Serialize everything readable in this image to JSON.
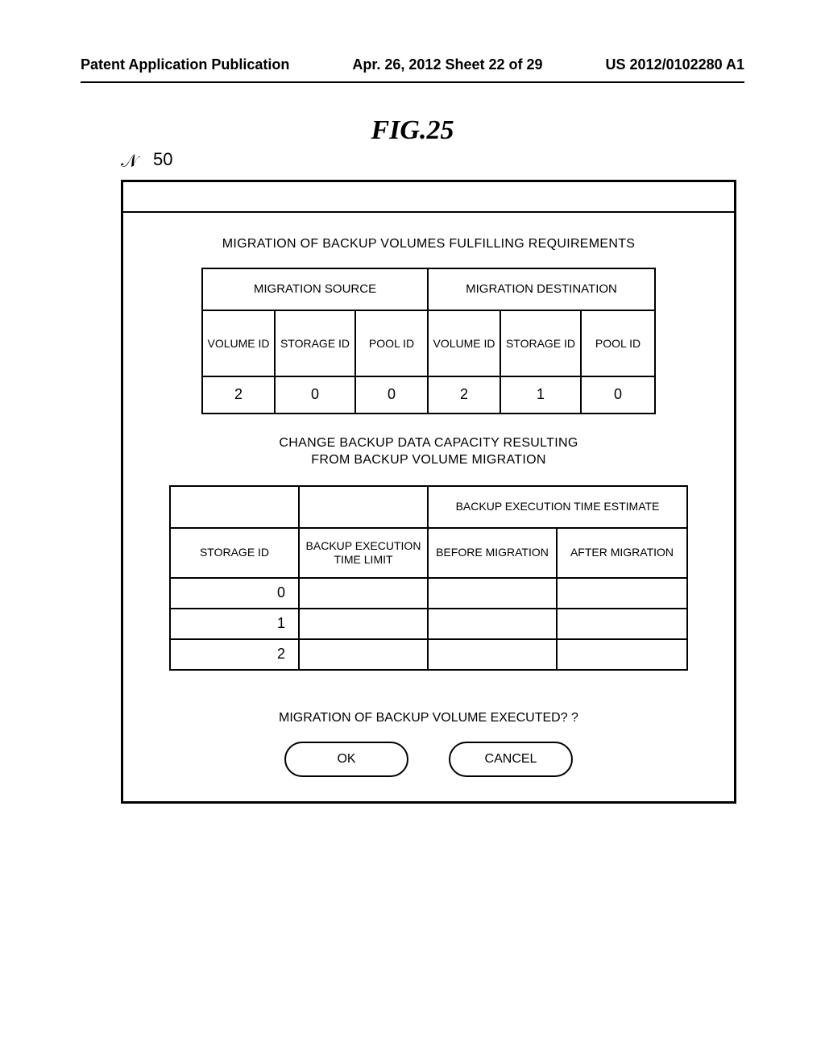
{
  "header": {
    "left": "Patent Application Publication",
    "middle": "Apr. 26, 2012  Sheet 22 of 29",
    "right": "US 2012/0102280 A1"
  },
  "figure": {
    "title": "FIG.25",
    "callout_number": "50"
  },
  "dialog": {
    "section1_title": "MIGRATION OF BACKUP VOLUMES FULFILLING REQUIREMENTS",
    "table1": {
      "group_headers": [
        "MIGRATION SOURCE",
        "MIGRATION DESTINATION"
      ],
      "sub_headers": [
        "VOLUME ID",
        "STORAGE ID",
        "POOL ID",
        "VOLUME ID",
        "STORAGE ID",
        "POOL ID"
      ],
      "rows": [
        [
          "2",
          "0",
          "0",
          "2",
          "1",
          "0"
        ]
      ]
    },
    "section2_title_line1": "CHANGE BACKUP DATA CAPACITY RESULTING",
    "section2_title_line2": "FROM BACKUP VOLUME MIGRATION",
    "table2": {
      "top_headers": {
        "estimate_group": "BACKUP EXECUTION TIME ESTIMATE"
      },
      "sub_headers": [
        "STORAGE ID",
        "BACKUP EXECUTION TIME LIMIT",
        "BEFORE MIGRATION",
        "AFTER MIGRATION"
      ],
      "rows": [
        {
          "storage_id": "0",
          "limit": "",
          "before": "",
          "after": ""
        },
        {
          "storage_id": "1",
          "limit": "",
          "before": "",
          "after": ""
        },
        {
          "storage_id": "2",
          "limit": "",
          "before": "",
          "after": ""
        }
      ]
    },
    "prompt": "MIGRATION OF BACKUP VOLUME EXECUTED?  ?",
    "ok_label": "OK",
    "cancel_label": "CANCEL"
  }
}
